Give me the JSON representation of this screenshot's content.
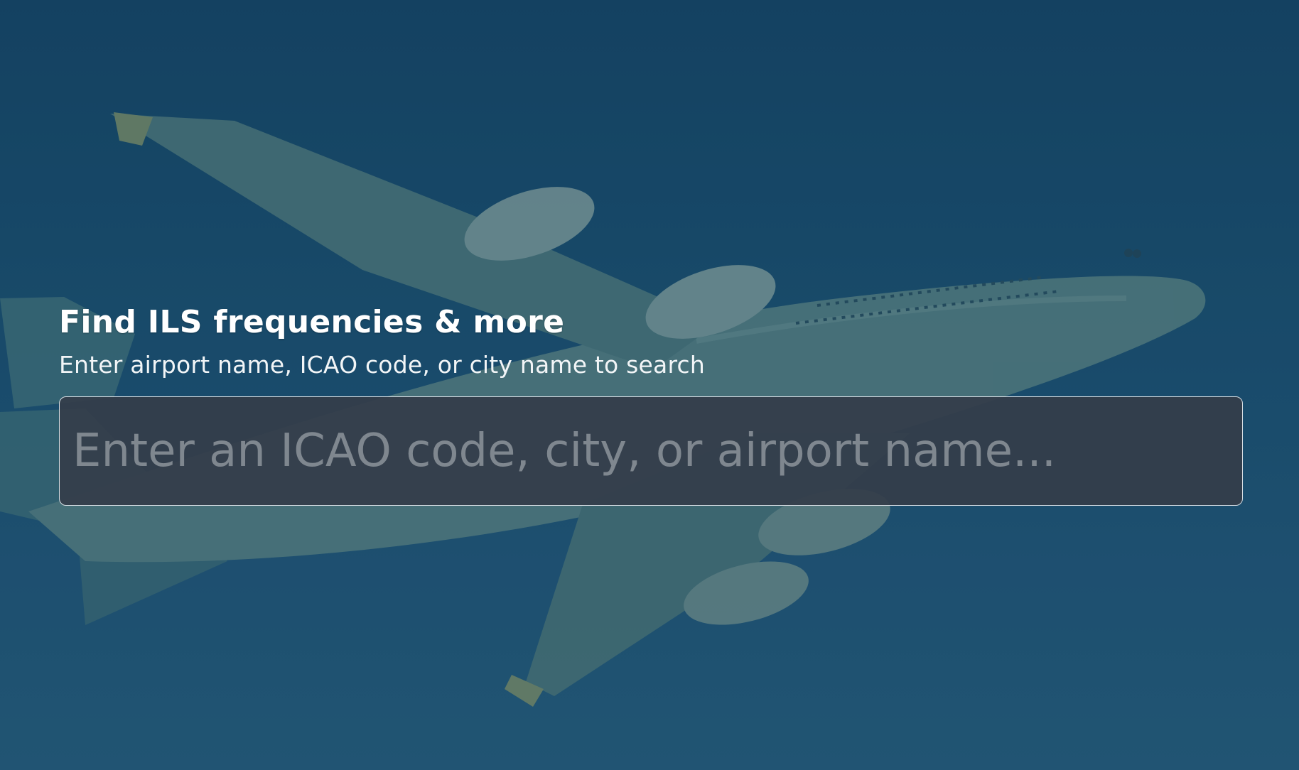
{
  "hero": {
    "title": "Find ILS frequencies & more",
    "subtitle": "Enter airport name, ICAO code, or city name to search",
    "background_image": "airliner-photo"
  },
  "search": {
    "value": "",
    "placeholder": "Enter an ICAO code, city, or airport name..."
  },
  "colors": {
    "sky_top": "#154362",
    "sky_bottom": "#255a78",
    "input_background": "#343e4a",
    "input_border": "#d7dde3",
    "placeholder_text": "#7f878f",
    "title_text": "#ffffff"
  }
}
